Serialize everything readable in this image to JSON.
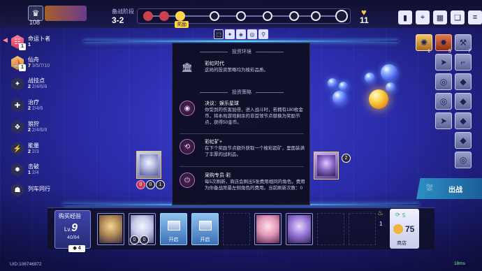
{
  "header": {
    "player_hp": "108",
    "stage_label": "备战阶段",
    "stage_value": "3-2",
    "current_tag": "奖励",
    "gold_top": "11"
  },
  "traits": [
    {
      "name": "命运卜者",
      "count_active": "1",
      "count_rest": "",
      "badge": "1",
      "style": "red"
    },
    {
      "name": "仙舟",
      "count_active": "7",
      "count_rest": "3/5/7/10",
      "badge": "1",
      "style": "gold"
    },
    {
      "name": "战技点",
      "count_active": "2",
      "count_rest": "2/4/6/8",
      "badge": "",
      "style": "plain"
    },
    {
      "name": "治疗",
      "count_active": "2",
      "count_rest": "2/4/6",
      "badge": "",
      "style": "plain"
    },
    {
      "name": "狼狩",
      "count_active": "2",
      "count_rest": "2/4/6/8",
      "badge": "",
      "style": "plain"
    },
    {
      "name": "能量",
      "count_active": "2",
      "count_rest": "2/3",
      "badge": "",
      "style": "plain"
    },
    {
      "name": "击破",
      "count_active": "1",
      "count_rest": "2/4",
      "badge": "",
      "style": "plain"
    },
    {
      "name": "列车同行",
      "count_active": "",
      "count_rest": "",
      "badge": "",
      "style": "plain"
    }
  ],
  "panel": {
    "env_section": "投资环境",
    "env_title": "彩虹时代",
    "env_desc": "这局的投资策略均为棱彩品质。",
    "strategy_section": "投资策略",
    "entries": [
      {
        "title": "决议：娱乐星球",
        "desc": "你受到的伤害加倍，进入战斗时，若拥有180枚金币，将本局游戏剩余的非首领节点替换为奖励节点，获得50金币。"
      },
      {
        "title": "彩虹矿+",
        "desc": "在下个奖励节点额外获取一个棱彩超矿，里面装满了丰厚的战利品。"
      },
      {
        "title": "采购专员·彩",
        "desc": "每5次刷新，商店会刷出5张费用相同的角色，费用为你备战席最左侧角色的费用。当前刷新次数：0"
      }
    ]
  },
  "board": {
    "left_bubbles": [
      "0",
      "0",
      "1"
    ],
    "right_bubble": "2"
  },
  "equipment": {
    "top": [
      {
        "icon": "gold-crest-icon",
        "count": "1",
        "style": "gold"
      },
      {
        "icon": "flame-icon",
        "count": "5",
        "style": "orange"
      },
      {
        "icon": "wrench-icon",
        "count": "7",
        "style": "plain"
      }
    ]
  },
  "bench": {
    "buy_exp_label": "购买经验",
    "lv_prefix": "Lv.",
    "level": "9",
    "exp": "40/84",
    "exp_cost": "4",
    "chest_label": "开启",
    "card_bubbles": [
      "0",
      "0"
    ]
  },
  "shop": {
    "refresh_count": "5",
    "gold": "75",
    "label": "商店",
    "reroll_count": "1"
  },
  "fight_label": "出战",
  "footer": {
    "uid": "UID:106746972",
    "ping": "18ms"
  }
}
